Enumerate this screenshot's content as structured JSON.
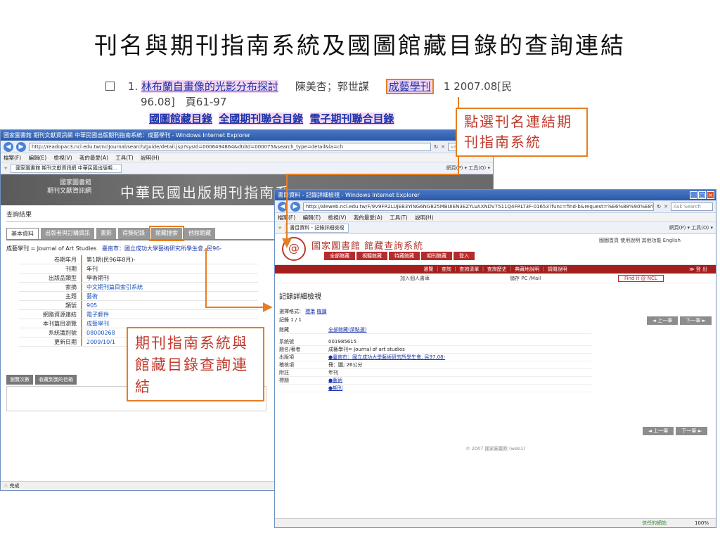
{
  "slide": {
    "title": "刊名與期刊指南系統及國圖館藏目錄的查詢連結"
  },
  "result": {
    "number": "1.",
    "article_title": "林布蘭自畫像的光影分布探討",
    "authors": "陳美杏；郭世謀",
    "journal": "成藝學刊",
    "issue_a": "1 2007.08[民",
    "issue_b": "96.08]　頁61-97",
    "link1": "國圖館藏目錄",
    "link2": "全國期刊聯合目錄",
    "link3": "電子期刊聯合目錄"
  },
  "callout1": {
    "text": "點選刊名連結期刊指南系統"
  },
  "callout2": {
    "text": "期刊指南系統與館藏目錄查詢連結"
  },
  "win1": {
    "title": "國家圖書館 期刊文獻資訊網 中華民國出版期刊指南系統：成藝學刊 - Windows Internet Explorer",
    "url": "http://readopac3.ncl.edu.tw/nclJournal/search/guide/detail.jsp?sysId=0006494864&dtdId=000075&search_type=detail&la=ch",
    "search": "van gogh",
    "menu": [
      "檔案(F)",
      "編輯(E)",
      "檢視(V)",
      "我的最愛(A)",
      "工具(T)",
      "說明(H)"
    ],
    "tab": "國家圖書館 期刊文獻資訊網 中華民國出版期...",
    "tools": "網頁(P) ▾  工具(O) ▾",
    "banner_small_1": "國家圖書館",
    "banner_small_2": "期刊文獻資訊網",
    "banner_big": "中華民國出版期刊指南系",
    "heading": "查詢結果",
    "tabs": [
      "基本資料",
      "出版者與訂購資訊",
      "書影",
      "得獎紀錄",
      "館藏搜索",
      "他館館藏"
    ],
    "record_title_label": "成藝學刊",
    "record_title_value": "= Journal of Art Studies",
    "record_publisher": "臺南市：國立成功大學藝術研究所學生會, 民96-",
    "rows": [
      {
        "k": "卷期年月",
        "v": "第1期(民96年8月)-"
      },
      {
        "k": "刊期",
        "v": "年刊"
      },
      {
        "k": "出版品類型",
        "v": "學術期刊"
      },
      {
        "k": "索摘",
        "v": "中文期刊篇目索引系統"
      },
      {
        "k": "主題",
        "v": "藝術"
      },
      {
        "k": "類號",
        "v": "905"
      },
      {
        "k": "網路資源連結",
        "v": "電子郵件"
      },
      {
        "k": "本刊篇目瀏覽",
        "v": "成藝學刊"
      },
      {
        "k": "系統識別號",
        "v": "08000268"
      },
      {
        "k": "更新日期",
        "v": "2009/10/1"
      }
    ],
    "lower_tabs": [
      "瀏覽次數",
      "收藏到我的信箱"
    ],
    "status": "完成"
  },
  "win2": {
    "title": "書目資料 - 記錄詳細檢視 - Windows Internet Explorer",
    "url": "http://aleweb.ncl.edu.tw/F/9V9FR2LUJEB3YING6NG825MBUIEN3EZYLVAXNDV7511Q4FRLT3F-01653?func=find-b&request=%E6%88%90%E8%97%9D%E5%AD%B8%E5%88%8A",
    "search": "Ask Search",
    "menu": [
      "檔案(F)",
      "編輯(E)",
      "檢視(V)",
      "我的最愛(A)",
      "工具(T)",
      "說明(H)"
    ],
    "tab": "書目資料 - 記錄詳細檢視",
    "tools": "網頁(P) ▾  工具(O) ▾",
    "site_name": "國家圖書館 館藏查詢系統",
    "site_top": "國圖首頁  使用說明  其他功能  English",
    "menu_tabs": [
      "全部館藏",
      "視聽館藏",
      "特藏館藏",
      "期刊館藏",
      "登入"
    ],
    "subnav": "瀏覽 ｜ 查詢 ｜ 查詢清單 ｜ 查詢歷史 ｜ 典藏地說明 ｜ 調閱說明",
    "exit": "≫ 登 出",
    "util_a": "加入個人書車",
    "util_b": "儲存 PC /Mail",
    "util_c": "Find it @ NCL",
    "heading": "記錄詳細檢視",
    "format_label": "選擇格式：",
    "format_1": "標準",
    "format_2": "機讀",
    "record_count": "記錄 1 / 1",
    "prev": "◄  上一筆",
    "next": "下一筆  ►",
    "rows": [
      {
        "k": "館藏",
        "v": "全部館藏(請點選)",
        "link": true
      },
      {
        "k": "",
        "v": "",
        "link": false
      },
      {
        "k": "系統號",
        "v": "001985615",
        "link": false
      },
      {
        "k": "題名/著者",
        "v": "成藝學刊= Journal of art studies",
        "link": false
      },
      {
        "k": "出版項",
        "v": "●臺南市：國立成功大學藝術研究所學生會, 民97.08-",
        "link": true
      },
      {
        "k": "稽核項",
        "v": "冊：圖; 26公分",
        "link": false
      },
      {
        "k": "附註",
        "v": "年刊",
        "link": false
      },
      {
        "k": "標題",
        "v": "●藝術",
        "link": true
      },
      {
        "k": "",
        "v": "●期刊",
        "link": true
      }
    ],
    "copyright": "© 2007 國家圖書館 (web1)",
    "status_trust": "信任的網站",
    "zoom": "100%"
  },
  "colors": {
    "accent": "#e67e22",
    "callout_text": "#c0392b",
    "link": "#1a33a8",
    "ie_title": "#2a58a8",
    "ncl_red": "#a61d1d"
  }
}
